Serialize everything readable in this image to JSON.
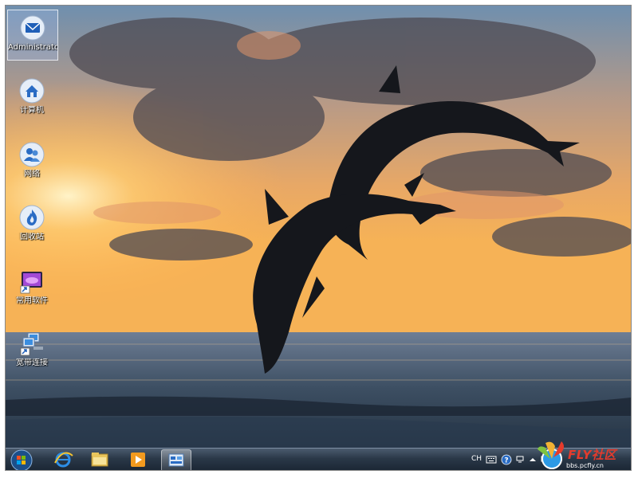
{
  "desktop": {
    "icons": [
      {
        "label": "Administrator",
        "icon": "mail-user-folder-icon",
        "selected": true
      },
      {
        "label": "计算机",
        "icon": "computer-home-icon"
      },
      {
        "label": "网络",
        "icon": "network-users-icon"
      },
      {
        "label": "回收站",
        "icon": "recycle-bin-flame-icon"
      },
      {
        "label": "常用软件",
        "icon": "software-folder-shortcut-icon"
      },
      {
        "label": "宽带连接",
        "icon": "broadband-connection-shortcut-icon"
      }
    ]
  },
  "taskbar": {
    "start": "windows-start-orb",
    "pinned": [
      "internet-explorer-icon",
      "file-explorer-icon",
      "media-player-icon",
      "control-panel-icon"
    ],
    "active_index": 3
  },
  "tray": {
    "language": "CH",
    "icons": [
      "keyboard-icon",
      "help-icon",
      "ime-icon",
      "show-hidden-arrow-icon",
      "network-tray-icon",
      "volume-icon"
    ]
  },
  "watermark": {
    "brand": "FLY社区",
    "sub": "bbs.pcfly.cn"
  }
}
